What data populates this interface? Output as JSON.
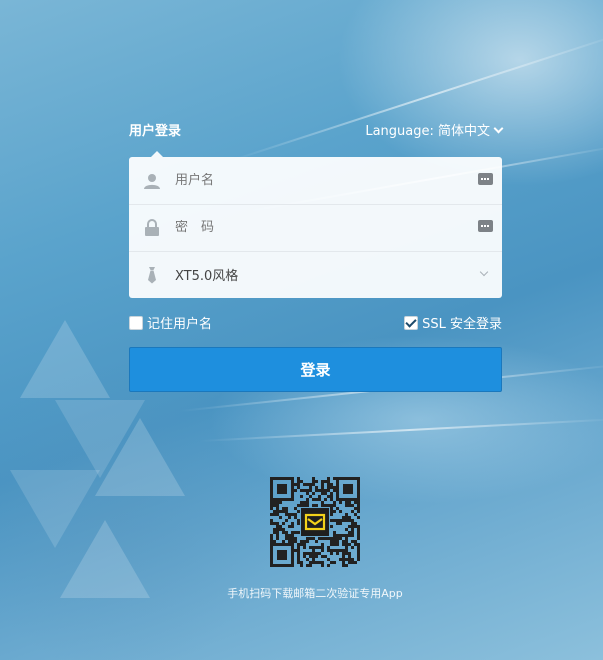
{
  "header": {
    "title": "用户登录",
    "language_label": "Language: 简体中文"
  },
  "form": {
    "username_placeholder": "用户名",
    "password_placeholder": "密　码",
    "style_selected": "XT5.0风格"
  },
  "options": {
    "remember_label": "记住用户名",
    "remember_checked": false,
    "ssl_label": "SSL 安全登录",
    "ssl_checked": true
  },
  "login_button": "登录",
  "qr": {
    "caption": "手机扫码下载邮箱二次验证专用App"
  },
  "colors": {
    "primary_button": "#1e8fde",
    "background": "#5aa3cc"
  }
}
